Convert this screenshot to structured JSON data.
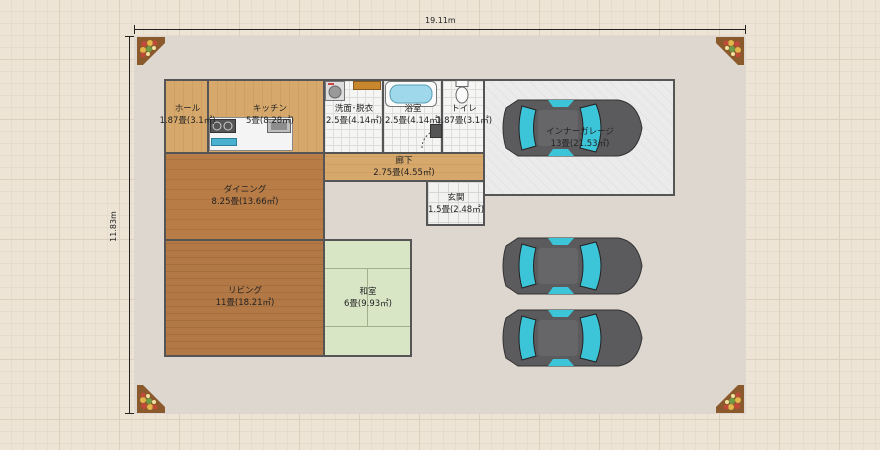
{
  "dimensions": {
    "width": "19.11m",
    "height": "11.83m"
  },
  "rooms": {
    "hall": {
      "name": "ホール",
      "area": "1.87畳(3.1㎡)"
    },
    "kitchen": {
      "name": "キッチン",
      "area": "5畳(8.28㎡)"
    },
    "washroom": {
      "name": "洗面･脱衣",
      "area": "2.5畳(4.14㎡)"
    },
    "bath": {
      "name": "浴室",
      "area": "2.5畳(4.14㎡)"
    },
    "toilet": {
      "name": "トイレ",
      "area": "1.87畳(3.1㎡)"
    },
    "garage": {
      "name": "インナーガレージ",
      "area": "13畳(21.53㎡)"
    },
    "corridor": {
      "name": "廊下",
      "area": "2.75畳(4.55㎡)"
    },
    "dining": {
      "name": "ダイニング",
      "area": "8.25畳(13.66㎡)"
    },
    "entrance": {
      "name": "玄関",
      "area": "1.5畳(2.48㎡)"
    },
    "living": {
      "name": "リビング",
      "area": "11畳(18.21㎡)"
    },
    "washitsu": {
      "name": "和室",
      "area": "6畳(9.93㎡)"
    }
  },
  "icons": [
    "plant-pot-icon",
    "car-icon",
    "bathtub-icon",
    "toilet-icon",
    "stove-icon",
    "sink-icon",
    "washing-machine-icon"
  ],
  "colors": {
    "wood_light": "#d4a468",
    "wood_dark": "#b67a45",
    "tatami": "#d9e6c6",
    "garage": "#ececec",
    "tile": "#f4f4f2",
    "car_body": "#5b5b5e",
    "car_glass": "#3cc4d8"
  }
}
